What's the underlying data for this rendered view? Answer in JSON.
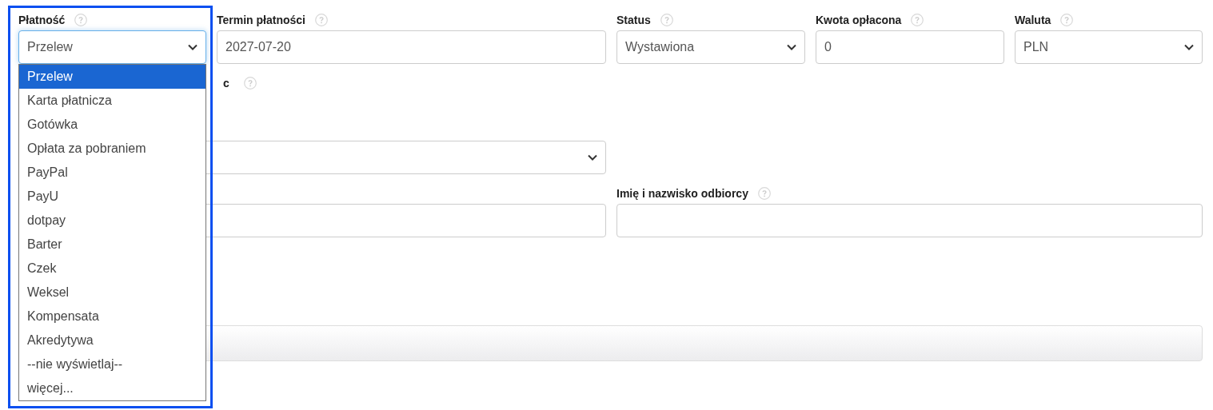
{
  "fields": [
    {
      "label": "Płatność",
      "kind": "select",
      "value": "Przelew",
      "expanded": true
    },
    {
      "label": "Termin płatności",
      "kind": "input",
      "value": "2027-07-20"
    },
    {
      "label": "Status",
      "kind": "select",
      "value": "Wystawiona",
      "expanded": false
    },
    {
      "label": "Kwota opłacona",
      "kind": "input",
      "value": "0"
    },
    {
      "label": "Waluta",
      "kind": "select",
      "value": "PLN",
      "expanded": false
    }
  ],
  "payment_options": [
    {
      "label": "Przelew",
      "selected": true
    },
    {
      "label": "Karta płatnicza",
      "selected": false
    },
    {
      "label": "Gotówka",
      "selected": false
    },
    {
      "label": "Opłata za pobraniem",
      "selected": false
    },
    {
      "label": "PayPal",
      "selected": false
    },
    {
      "label": "PayU",
      "selected": false
    },
    {
      "label": "dotpay",
      "selected": false
    },
    {
      "label": "Barter",
      "selected": false
    },
    {
      "label": "Czek",
      "selected": false
    },
    {
      "label": "Weksel",
      "selected": false
    },
    {
      "label": "Kompensata",
      "selected": false
    },
    {
      "label": "Akredytywa",
      "selected": false
    },
    {
      "label": "--nie wyświetlaj--",
      "selected": false
    },
    {
      "label": "więcej...",
      "selected": false
    }
  ],
  "lower_rows": [
    {
      "kind": "label_fragment",
      "text": "c"
    },
    {
      "kind": "select"
    },
    {
      "kind": "input_pair",
      "label": "Imię i nazwisko odbiorcy"
    },
    {
      "kind": "bar"
    }
  ]
}
